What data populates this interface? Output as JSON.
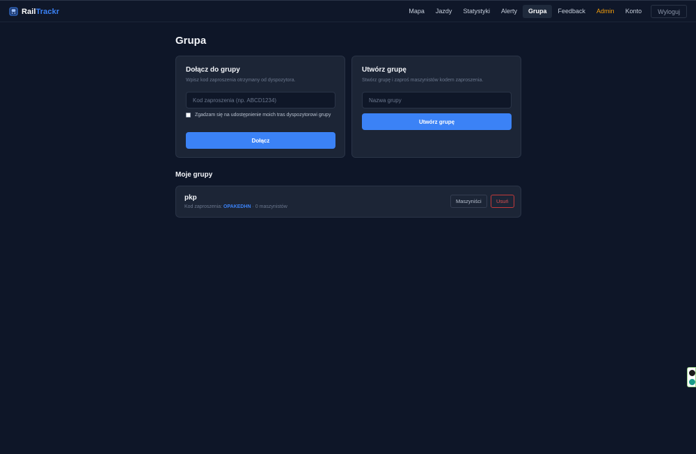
{
  "brand": {
    "name_part1": "Rail",
    "name_part2": "Trackr",
    "icon": "train-icon"
  },
  "nav": {
    "items": [
      {
        "label": "Mapa"
      },
      {
        "label": "Jazdy"
      },
      {
        "label": "Statystyki"
      },
      {
        "label": "Alerty"
      },
      {
        "label": "Grupa",
        "active": true
      },
      {
        "label": "Feedback"
      },
      {
        "label": "Admin"
      },
      {
        "label": "Konto"
      }
    ],
    "logout_label": "Wyloguj"
  },
  "page": {
    "title": "Grupa"
  },
  "join_card": {
    "title": "Dołącz do grupy",
    "description": "Wpisz kod zaproszenia otrzymany od dyspozytora.",
    "code_placeholder": "Kod zaproszenia (np. ABCD1234)",
    "consent_label": "Zgadzam się na udostępnienie moich tras dyspozytorowi grupy",
    "consent_checked": false,
    "submit_label": "Dołącz"
  },
  "create_card": {
    "title": "Utwórz grupę",
    "description": "Stwórz grupę i zaproś maszynistów kodem zaproszenia.",
    "name_placeholder": "Nazwa grupy",
    "submit_label": "Utwórz grupę"
  },
  "my_groups": {
    "title": "Moje grupy",
    "groups": [
      {
        "name": "pkp",
        "invite_prefix": "Kod zaproszenia:",
        "invite_code": "OPAKEDHN",
        "separator": "·",
        "drivers_text": "0 maszynistów",
        "drivers_button": "Maszyniści",
        "delete_button": "Usuń"
      }
    ]
  },
  "colors": {
    "background": "#0e1628",
    "card": "#1c2536",
    "accent": "#3b82f6",
    "admin": "#f59e0b",
    "danger": "#e05252"
  }
}
